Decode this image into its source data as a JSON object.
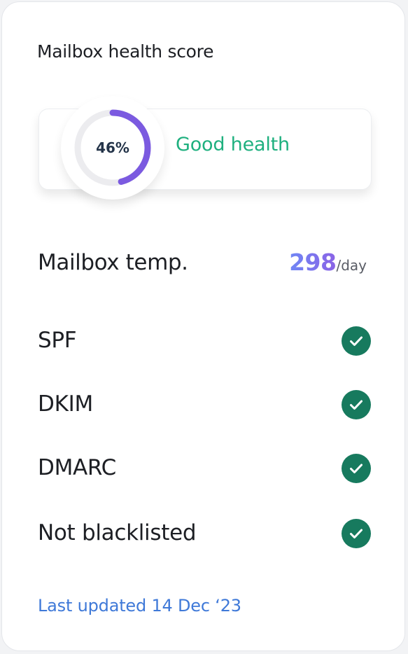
{
  "card": {
    "title": "Mailbox health score"
  },
  "health": {
    "score_label": "46%",
    "score_fraction": 0.46,
    "status": "Good health",
    "ring_color": "#7b5ae0",
    "track_color": "#ececef",
    "status_color": "#1fb07f"
  },
  "temperature": {
    "label": "Mailbox temp.",
    "value": "298",
    "unit": "/day"
  },
  "checks": [
    {
      "label": "SPF",
      "icon": "check-circle-icon",
      "status": "passed"
    },
    {
      "label": "DKIM",
      "icon": "check-circle-icon",
      "status": "passed"
    },
    {
      "label": "DMARC",
      "icon": "check-circle-icon",
      "status": "passed"
    },
    {
      "label": "Not blacklisted",
      "icon": "check-circle-icon",
      "status": "passed"
    }
  ],
  "check_color": "#177a5e",
  "footer": {
    "last_updated": "Last updated 14 Dec ‘23"
  }
}
